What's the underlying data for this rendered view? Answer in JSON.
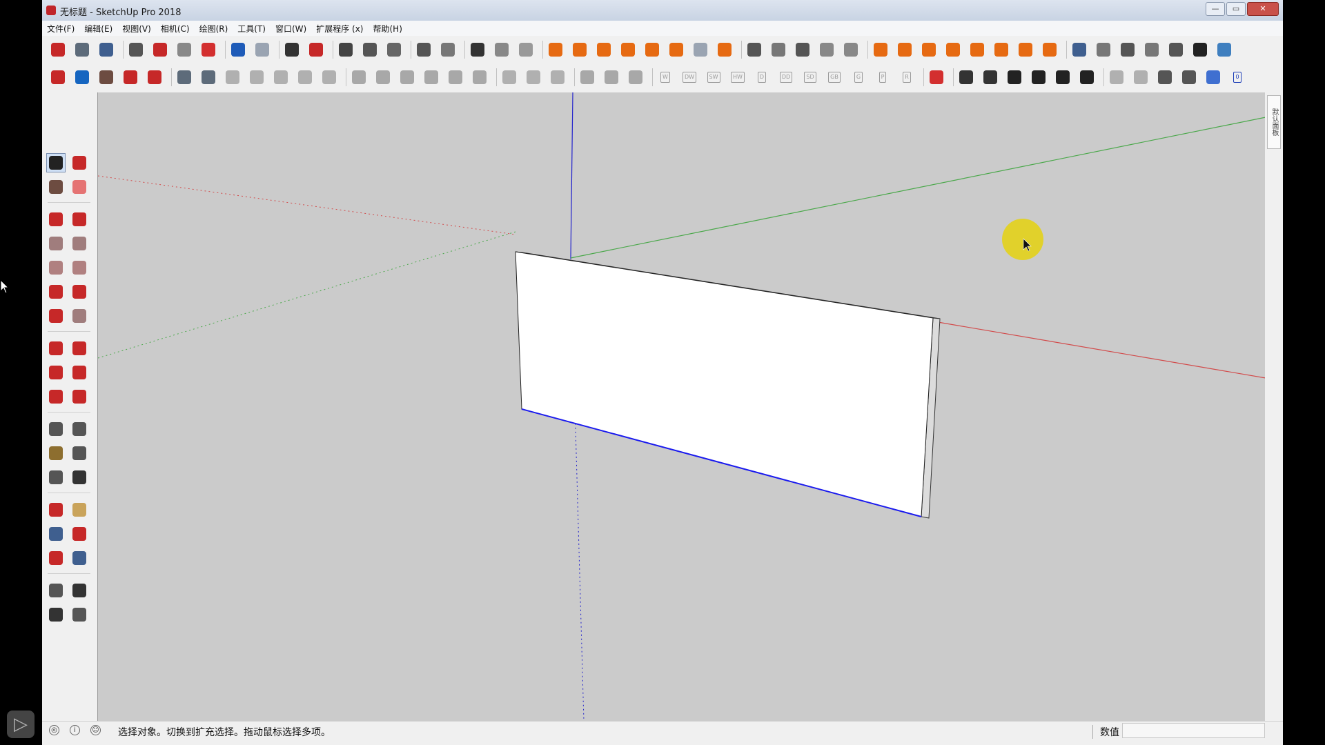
{
  "window": {
    "title": "无标题 - SketchUp Pro 2018",
    "controls": {
      "minimize": "—",
      "maximize": "▭",
      "close": "✕"
    }
  },
  "menu": [
    "文件(F)",
    "编辑(E)",
    "视图(V)",
    "相机(C)",
    "绘图(R)",
    "工具(T)",
    "窗口(W)",
    "扩展程序 (x)",
    "帮助(H)"
  ],
  "toolbar1": [
    {
      "name": "new-button",
      "icon": "new-file-icon",
      "color": "#c62828"
    },
    {
      "name": "open-button",
      "icon": "open-icon",
      "color": "#5d6b7a"
    },
    {
      "name": "save-button",
      "icon": "save-icon",
      "color": "#3f5f8f"
    },
    {
      "sep": true
    },
    {
      "name": "cut-button",
      "icon": "scissors-icon",
      "color": "#555555"
    },
    {
      "name": "copy-button",
      "icon": "copy-icon",
      "color": "#c62828"
    },
    {
      "name": "paste-button",
      "icon": "paste-icon",
      "color": "#888888"
    },
    {
      "name": "erase-button",
      "icon": "delete-icon",
      "color": "#d32f2f"
    },
    {
      "sep": true
    },
    {
      "name": "undo-button",
      "icon": "undo-icon",
      "color": "#1e5bb8"
    },
    {
      "name": "redo-button",
      "icon": "redo-icon",
      "color": "#9aa4b2"
    },
    {
      "sep": true
    },
    {
      "name": "print-button",
      "icon": "printer-icon",
      "color": "#333333"
    },
    {
      "name": "model-info-button",
      "icon": "model-info-icon",
      "color": "#c62828"
    },
    {
      "sep": true
    },
    {
      "name": "validity-button",
      "icon": "check-circle-icon",
      "color": "#444444"
    },
    {
      "name": "warehouse-button",
      "icon": "teapot-icon",
      "color": "#555555"
    },
    {
      "name": "extension-warehouse-button",
      "icon": "hands-icon",
      "color": "#666666"
    },
    {
      "sep": true
    },
    {
      "name": "sandbox-button",
      "icon": "terrain-icon",
      "color": "#555555"
    },
    {
      "name": "section-button",
      "icon": "section-icon",
      "color": "#777777"
    },
    {
      "sep": true
    },
    {
      "name": "window-button",
      "icon": "window-icon",
      "color": "#333333"
    },
    {
      "name": "window-2-button",
      "icon": "window-copy-icon",
      "color": "#888888"
    },
    {
      "name": "lock-button",
      "icon": "lock-icon",
      "color": "#999999"
    },
    {
      "sep": true
    },
    {
      "name": "plant-button",
      "icon": "plant-icon",
      "color": "#e66a12"
    },
    {
      "name": "circle-tool-button",
      "icon": "concentric-circle-icon",
      "color": "#e66a12"
    },
    {
      "name": "angle-button",
      "icon": "angle-icon",
      "color": "#e66a12"
    },
    {
      "name": "umbrella-button",
      "icon": "umbrella-icon",
      "color": "#e66a12"
    },
    {
      "name": "spark-button",
      "icon": "spark-icon",
      "color": "#e66a12"
    },
    {
      "name": "dome-button",
      "icon": "dome-icon",
      "color": "#e66a12"
    },
    {
      "name": "sphere-button",
      "icon": "sphere-icon",
      "color": "#9aa4b2"
    },
    {
      "name": "light-button",
      "icon": "light-icon",
      "color": "#e66a12"
    },
    {
      "sep": true
    },
    {
      "name": "shed-button",
      "icon": "shed-icon",
      "color": "#555555"
    },
    {
      "name": "box-button",
      "icon": "box-icon",
      "color": "#777777"
    },
    {
      "name": "box-open-button",
      "icon": "box-open-icon",
      "color": "#555555"
    },
    {
      "name": "grass-button",
      "icon": "grass-icon",
      "color": "#888888"
    },
    {
      "name": "leaf-button",
      "icon": "leaf-icon",
      "color": "#888888"
    },
    {
      "sep": true
    },
    {
      "name": "power-button",
      "icon": "power-icon",
      "color": "#e66a12"
    },
    {
      "name": "boxes-button",
      "icon": "boxes-icon",
      "color": "#e66a12"
    },
    {
      "name": "folder-button",
      "icon": "folder-icon",
      "color": "#e66a12"
    },
    {
      "name": "bin-button",
      "icon": "trash-icon",
      "color": "#e66a12"
    },
    {
      "name": "shuffle-button",
      "icon": "shuffle-icon",
      "color": "#e66a12"
    },
    {
      "name": "tag-button",
      "icon": "tag-icon",
      "color": "#e66a12"
    },
    {
      "name": "zoom-frame-button",
      "icon": "frame-icon",
      "color": "#e66a12"
    },
    {
      "name": "comment-button",
      "icon": "comment-icon",
      "color": "#e66a12"
    },
    {
      "sep": true
    },
    {
      "name": "style-shaded-button",
      "icon": "solid-cube-icon",
      "color": "#3f5f8f"
    },
    {
      "name": "style-wire-button",
      "icon": "wire-cube-icon",
      "color": "#777777"
    },
    {
      "name": "style-hidden-button",
      "icon": "hidden-cube-icon",
      "color": "#555555"
    },
    {
      "name": "style-xray-button",
      "icon": "xray-cube-icon",
      "color": "#777777"
    },
    {
      "name": "style-mono-button",
      "icon": "mono-cube-icon",
      "color": "#555555"
    },
    {
      "name": "layers-button",
      "icon": "layers-icon",
      "color": "#222222"
    },
    {
      "name": "style-color-button",
      "icon": "color-cube-icon",
      "color": "#3f7fbf"
    }
  ],
  "toolbar2": [
    {
      "name": "plugin-1-button",
      "icon": "grid-color-icon",
      "color": "#c62828"
    },
    {
      "name": "plugin-2-button",
      "icon": "grid-color-2-icon",
      "color": "#1565c0"
    },
    {
      "name": "plugin-3-button",
      "icon": "house-gear-icon",
      "color": "#6d4c41"
    },
    {
      "name": "plugin-4-button",
      "icon": "house-color-icon",
      "color": "#c62828"
    },
    {
      "name": "plugin-5-button",
      "icon": "info-box-icon",
      "color": "#c62828"
    },
    {
      "sep": true
    },
    {
      "name": "grid-1-button",
      "icon": "grid-icon",
      "color": "#5d6b7a"
    },
    {
      "name": "grid-2-button",
      "icon": "grid-icon",
      "color": "#5d6b7a"
    },
    {
      "name": "grid-3-button",
      "icon": "grid-icon",
      "color": "#b0b0b0"
    },
    {
      "name": "grid-4-button",
      "icon": "grid-icon",
      "color": "#b0b0b0"
    },
    {
      "name": "grid-5-button",
      "icon": "grid-icon",
      "color": "#b0b0b0"
    },
    {
      "name": "grid-6-button",
      "icon": "grid-icon",
      "color": "#b0b0b0"
    },
    {
      "name": "grid-7-button",
      "icon": "grid-icon",
      "color": "#b0b0b0"
    },
    {
      "sep": true
    },
    {
      "name": "move-axis-1-button",
      "icon": "cross-icon",
      "color": "#a8a8a8"
    },
    {
      "name": "move-axis-2-button",
      "icon": "cross-icon",
      "color": "#a8a8a8"
    },
    {
      "name": "move-axis-3-button",
      "icon": "cross-icon",
      "color": "#a8a8a8"
    },
    {
      "name": "move-axis-4-button",
      "icon": "cross-icon",
      "color": "#a8a8a8"
    },
    {
      "name": "align-1-button",
      "icon": "align-icon",
      "color": "#a8a8a8"
    },
    {
      "name": "align-2-button",
      "icon": "align-icon",
      "color": "#a8a8a8"
    },
    {
      "sep": true
    },
    {
      "name": "frame-1-button",
      "icon": "frame-icon",
      "color": "#b0b0b0"
    },
    {
      "name": "frame-2-button",
      "icon": "frame-icon",
      "color": "#b0b0b0"
    },
    {
      "name": "frame-3-button",
      "icon": "frame-icon",
      "color": "#b0b0b0"
    },
    {
      "sep": true
    },
    {
      "name": "wall-1-button",
      "icon": "wall-icon",
      "color": "#a8a8a8"
    },
    {
      "name": "wall-2-button",
      "icon": "wall-icon",
      "color": "#a8a8a8"
    },
    {
      "name": "wall-3-button",
      "icon": "wall-icon",
      "color": "#a8a8a8"
    },
    {
      "sep": true
    },
    {
      "name": "w-button",
      "label": "W",
      "color": "#9a9a9a"
    },
    {
      "name": "dw-button",
      "label": "DW",
      "color": "#9a9a9a"
    },
    {
      "name": "sw-button",
      "label": "SW",
      "color": "#9a9a9a"
    },
    {
      "name": "hw-button",
      "label": "HW",
      "color": "#9a9a9a"
    },
    {
      "name": "d-button",
      "label": "D",
      "color": "#9a9a9a"
    },
    {
      "name": "dd-button",
      "label": "DD",
      "color": "#9a9a9a"
    },
    {
      "name": "sd-button",
      "label": "SD",
      "color": "#9a9a9a"
    },
    {
      "name": "gb-button",
      "label": "GB",
      "color": "#9a9a9a"
    },
    {
      "name": "g-button",
      "label": "G",
      "color": "#9a9a9a"
    },
    {
      "name": "p-button",
      "label": "P",
      "color": "#9a9a9a"
    },
    {
      "name": "r-button",
      "label": "R",
      "color": "#9a9a9a"
    },
    {
      "sep": true
    },
    {
      "name": "panel-button",
      "icon": "panel-icon",
      "color": "#d32f2f"
    },
    {
      "sep": true
    },
    {
      "name": "view-iso-button",
      "icon": "iso-house-icon",
      "color": "#333333"
    },
    {
      "name": "view-top-button",
      "icon": "top-view-icon",
      "color": "#333333"
    },
    {
      "name": "view-front-button",
      "icon": "front-house-icon",
      "color": "#222222"
    },
    {
      "name": "view-right-button",
      "icon": "right-house-icon",
      "color": "#222222"
    },
    {
      "name": "view-back-button",
      "icon": "back-house-icon",
      "color": "#222222"
    },
    {
      "name": "view-left-button",
      "icon": "left-house-icon",
      "color": "#222222"
    },
    {
      "sep": true
    },
    {
      "name": "face-1-button",
      "icon": "face-icon",
      "color": "#b0b0b0"
    },
    {
      "name": "face-2-button",
      "icon": "face-icon",
      "color": "#b0b0b0"
    },
    {
      "name": "face-3-button",
      "icon": "face-icon",
      "color": "#555555"
    },
    {
      "name": "face-4-button",
      "icon": "face-icon",
      "color": "#555555"
    },
    {
      "name": "face-5-button",
      "icon": "face-icon",
      "color": "#3f6fd0"
    },
    {
      "name": "zero-button",
      "label": "0",
      "color": "#1e3fb8"
    }
  ],
  "tools": [
    [
      {
        "name": "select-tool",
        "icon": "arrow-icon",
        "color": "#222222",
        "active": true
      },
      {
        "name": "make-component-tool",
        "icon": "component-icon",
        "color": "#c62828"
      }
    ],
    [
      {
        "name": "paint-bucket-tool",
        "icon": "paint-bucket-icon",
        "color": "#6d4c41"
      },
      {
        "name": "eraser-tool",
        "icon": "eraser-icon",
        "color": "#e57373"
      }
    ],
    "sep",
    [
      {
        "name": "line-tool",
        "icon": "pencil-icon",
        "color": "#c62828"
      },
      {
        "name": "freehand-tool",
        "icon": "freehand-icon",
        "color": "#c62828"
      }
    ],
    [
      {
        "name": "rectangle-tool",
        "icon": "rectangle-icon",
        "color": "#a07d7d"
      },
      {
        "name": "rotated-rectangle-tool",
        "icon": "rotated-rectangle-icon",
        "color": "#a07d7d"
      }
    ],
    [
      {
        "name": "circle-tool",
        "icon": "circle-icon",
        "color": "#b08080"
      },
      {
        "name": "polygon-tool",
        "icon": "polygon-icon",
        "color": "#b08080"
      }
    ],
    [
      {
        "name": "arc-tool",
        "icon": "arc-icon",
        "color": "#c62828"
      },
      {
        "name": "two-point-arc-tool",
        "icon": "two-point-arc-icon",
        "color": "#c62828"
      }
    ],
    [
      {
        "name": "three-point-arc-tool",
        "icon": "three-point-arc-icon",
        "color": "#c62828"
      },
      {
        "name": "pie-tool",
        "icon": "pie-icon",
        "color": "#a07d7d"
      }
    ],
    "sep",
    [
      {
        "name": "move-tool",
        "icon": "move-icon",
        "color": "#c62828"
      },
      {
        "name": "push-pull-tool",
        "icon": "push-pull-icon",
        "color": "#c62828"
      }
    ],
    [
      {
        "name": "rotate-tool",
        "icon": "rotate-icon",
        "color": "#c62828"
      },
      {
        "name": "follow-me-tool",
        "icon": "follow-me-icon",
        "color": "#c62828"
      }
    ],
    [
      {
        "name": "scale-tool",
        "icon": "scale-icon",
        "color": "#c62828"
      },
      {
        "name": "offset-tool",
        "icon": "offset-icon",
        "color": "#c62828"
      }
    ],
    "sep",
    [
      {
        "name": "tape-measure-tool",
        "icon": "tape-icon",
        "color": "#555555"
      },
      {
        "name": "dimension-tool",
        "icon": "dimension-icon",
        "color": "#555555"
      }
    ],
    [
      {
        "name": "protractor-tool",
        "icon": "protractor-icon",
        "color": "#8d6e2f"
      },
      {
        "name": "text-tool",
        "icon": "text-a1-icon",
        "color": "#555555"
      }
    ],
    [
      {
        "name": "axes-tool",
        "icon": "axes-icon",
        "color": "#555555"
      },
      {
        "name": "3d-text-tool",
        "icon": "3d-text-icon",
        "color": "#333333"
      }
    ],
    "sep",
    [
      {
        "name": "orbit-tool",
        "icon": "orbit-icon",
        "color": "#c62828"
      },
      {
        "name": "pan-tool",
        "icon": "hand-icon",
        "color": "#c9a35a"
      }
    ],
    [
      {
        "name": "zoom-tool",
        "icon": "zoom-icon",
        "color": "#3f5f8f"
      },
      {
        "name": "zoom-window-tool",
        "icon": "zoom-window-icon",
        "color": "#c62828"
      }
    ],
    [
      {
        "name": "zoom-extents-tool",
        "icon": "zoom-extents-icon",
        "color": "#c62828"
      },
      {
        "name": "previous-view-tool",
        "icon": "previous-view-icon",
        "color": "#3f5f8f"
      }
    ],
    "sep",
    [
      {
        "name": "position-camera-tool",
        "icon": "person-icon",
        "color": "#555555"
      },
      {
        "name": "look-around-tool",
        "icon": "eye-icon",
        "color": "#333333"
      }
    ],
    [
      {
        "name": "walk-tool",
        "icon": "footprints-icon",
        "color": "#333333"
      },
      {
        "name": "section-plane-tool",
        "icon": "section-plane-icon",
        "color": "#555555"
      }
    ]
  ],
  "tray": {
    "tab_label": "默认面板"
  },
  "status": {
    "message": "选择对象。切换到扩充选择。拖动鼠标选择多项。",
    "vcb_label": "数值",
    "vcb_value": ""
  },
  "viewport": {
    "background": "#cbcbcb",
    "axis_colors": {
      "red": "#d24a4a",
      "green": "#4aa84a",
      "blue": "#2222cc"
    },
    "highlight_color": "#e3d21a"
  },
  "watermark": {
    "glyph": "▷"
  }
}
